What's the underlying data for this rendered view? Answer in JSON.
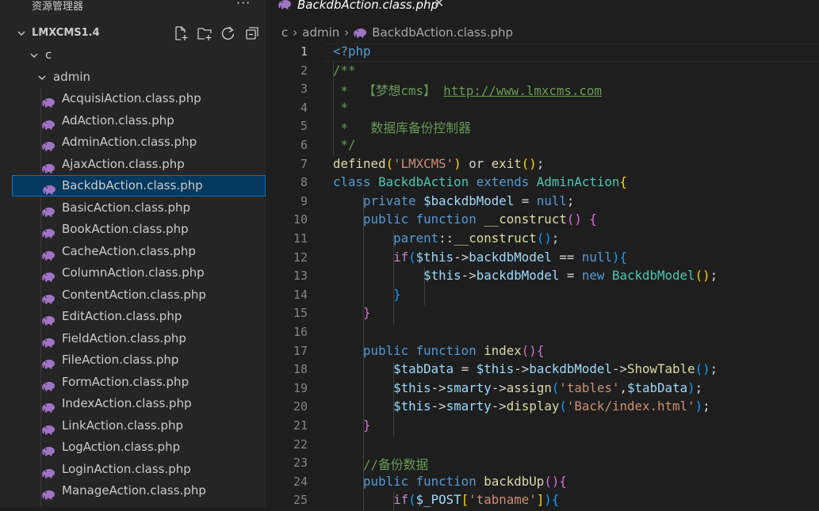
{
  "sidebar": {
    "title": "资源管理器",
    "more": "···",
    "project": "LMXCMS1.4",
    "folders": [
      {
        "label": "c"
      },
      {
        "label": "admin"
      }
    ],
    "files": [
      "AcquisiAction.class.php",
      "AdAction.class.php",
      "AdminAction.class.php",
      "AjaxAction.class.php",
      "BackdbAction.class.php",
      "BasicAction.class.php",
      "BookAction.class.php",
      "CacheAction.class.php",
      "ColumnAction.class.php",
      "ContentAction.class.php",
      "EditAction.class.php",
      "FieldAction.class.php",
      "FileAction.class.php",
      "FormAction.class.php",
      "IndexAction.class.php",
      "LinkAction.class.php",
      "LogAction.class.php",
      "LoginAction.class.php",
      "ManageAction.class.php"
    ],
    "selected_file": "BackdbAction.class.php"
  },
  "tab": {
    "label": "BackdbAction.class.php",
    "close": "✕"
  },
  "breadcrumb": {
    "parts": [
      "c",
      "admin",
      "BackdbAction.class.php"
    ]
  },
  "editor": {
    "current_line": 1,
    "lines": [
      {
        "n": "1",
        "t": [
          [
            "tag",
            "<?php"
          ]
        ]
      },
      {
        "n": "2",
        "t": [
          [
            "com",
            "/**"
          ]
        ]
      },
      {
        "n": "3",
        "t": [
          [
            "com",
            " *  【梦想cms】 "
          ],
          [
            "url",
            "http://www.lmxcms.com"
          ]
        ]
      },
      {
        "n": "4",
        "t": [
          [
            "com",
            " *"
          ]
        ]
      },
      {
        "n": "5",
        "t": [
          [
            "com",
            " *   数据库备份控制器"
          ]
        ]
      },
      {
        "n": "6",
        "t": [
          [
            "com",
            " */"
          ]
        ]
      },
      {
        "n": "7",
        "t": [
          [
            "fn",
            "defined"
          ],
          [
            "b1",
            "("
          ],
          [
            "str",
            "'LMXCMS'"
          ],
          [
            "b1",
            ")"
          ],
          [
            "txt",
            " or "
          ],
          [
            "fn",
            "exit"
          ],
          [
            "b1",
            "()"
          ],
          [
            "txt",
            ";"
          ]
        ]
      },
      {
        "n": "8",
        "t": [
          [
            "kw",
            "class "
          ],
          [
            "cls",
            "BackdbAction "
          ],
          [
            "kw",
            "extends "
          ],
          [
            "cls",
            "AdminAction"
          ],
          [
            "b1",
            "{"
          ]
        ]
      },
      {
        "n": "9",
        "t": [
          [
            "txt",
            "    "
          ],
          [
            "kw",
            "private "
          ],
          [
            "var",
            "$backdbModel"
          ],
          [
            "txt",
            " = "
          ],
          [
            "kw",
            "null"
          ],
          [
            "txt",
            ";"
          ]
        ]
      },
      {
        "n": "10",
        "t": [
          [
            "txt",
            "    "
          ],
          [
            "kw",
            "public function "
          ],
          [
            "fn",
            "__construct"
          ],
          [
            "b2",
            "()"
          ],
          [
            "txt",
            " "
          ],
          [
            "b2",
            "{"
          ]
        ]
      },
      {
        "n": "11",
        "t": [
          [
            "txt",
            "        "
          ],
          [
            "kw",
            "parent"
          ],
          [
            "txt",
            "::"
          ],
          [
            "fn",
            "__construct"
          ],
          [
            "b3",
            "()"
          ],
          [
            "txt",
            ";"
          ]
        ]
      },
      {
        "n": "12",
        "t": [
          [
            "txt",
            "        "
          ],
          [
            "ctl",
            "if"
          ],
          [
            "b3",
            "("
          ],
          [
            "var",
            "$this"
          ],
          [
            "txt",
            "->"
          ],
          [
            "var",
            "backdbModel"
          ],
          [
            "txt",
            " == "
          ],
          [
            "kw",
            "null"
          ],
          [
            "b3",
            ")"
          ],
          [
            "b3",
            "{"
          ]
        ]
      },
      {
        "n": "13",
        "t": [
          [
            "txt",
            "            "
          ],
          [
            "var",
            "$this"
          ],
          [
            "txt",
            "->"
          ],
          [
            "var",
            "backdbModel"
          ],
          [
            "txt",
            " = "
          ],
          [
            "kw",
            "new "
          ],
          [
            "cls",
            "BackdbModel"
          ],
          [
            "b1",
            "()"
          ],
          [
            "txt",
            ";"
          ]
        ]
      },
      {
        "n": "14",
        "t": [
          [
            "txt",
            "        "
          ],
          [
            "b3",
            "}"
          ]
        ]
      },
      {
        "n": "15",
        "t": [
          [
            "txt",
            "    "
          ],
          [
            "b2",
            "}"
          ]
        ]
      },
      {
        "n": "16",
        "t": []
      },
      {
        "n": "17",
        "t": [
          [
            "txt",
            "    "
          ],
          [
            "kw",
            "public function "
          ],
          [
            "fn",
            "index"
          ],
          [
            "b2",
            "()"
          ],
          [
            "b2",
            "{"
          ]
        ]
      },
      {
        "n": "18",
        "t": [
          [
            "txt",
            "        "
          ],
          [
            "var",
            "$tabData"
          ],
          [
            "txt",
            " = "
          ],
          [
            "var",
            "$this"
          ],
          [
            "txt",
            "->"
          ],
          [
            "var",
            "backdbModel"
          ],
          [
            "txt",
            "->"
          ],
          [
            "fn",
            "ShowTable"
          ],
          [
            "b3",
            "()"
          ],
          [
            "txt",
            ";"
          ]
        ]
      },
      {
        "n": "19",
        "t": [
          [
            "txt",
            "        "
          ],
          [
            "var",
            "$this"
          ],
          [
            "txt",
            "->"
          ],
          [
            "var",
            "smarty"
          ],
          [
            "txt",
            "->"
          ],
          [
            "fn",
            "assign"
          ],
          [
            "b3",
            "("
          ],
          [
            "str",
            "'tables'"
          ],
          [
            "txt",
            ","
          ],
          [
            "var",
            "$tabData"
          ],
          [
            "b3",
            ")"
          ],
          [
            "txt",
            ";"
          ]
        ]
      },
      {
        "n": "20",
        "t": [
          [
            "txt",
            "        "
          ],
          [
            "var",
            "$this"
          ],
          [
            "txt",
            "->"
          ],
          [
            "var",
            "smarty"
          ],
          [
            "txt",
            "->"
          ],
          [
            "fn",
            "display"
          ],
          [
            "b3",
            "("
          ],
          [
            "str",
            "'Back/index.html'"
          ],
          [
            "b3",
            ")"
          ],
          [
            "txt",
            ";"
          ]
        ]
      },
      {
        "n": "21",
        "t": [
          [
            "txt",
            "    "
          ],
          [
            "b2",
            "}"
          ]
        ]
      },
      {
        "n": "22",
        "t": []
      },
      {
        "n": "23",
        "t": [
          [
            "txt",
            "    "
          ],
          [
            "com",
            "//备份数据"
          ]
        ]
      },
      {
        "n": "24",
        "t": [
          [
            "txt",
            "    "
          ],
          [
            "kw",
            "public function "
          ],
          [
            "fn",
            "backdbUp"
          ],
          [
            "b2",
            "()"
          ],
          [
            "b2",
            "{"
          ]
        ]
      },
      {
        "n": "25",
        "t": [
          [
            "txt",
            "        "
          ],
          [
            "ctl",
            "if"
          ],
          [
            "b3",
            "("
          ],
          [
            "var",
            "$_POST"
          ],
          [
            "b1",
            "["
          ],
          [
            "str",
            "'tabname'"
          ],
          [
            "b1",
            "]"
          ],
          [
            "b3",
            ")"
          ],
          [
            "b3",
            "{"
          ]
        ]
      }
    ]
  },
  "colors": {
    "sidebar_bg": "#252526",
    "editor_bg": "#1e1e1e",
    "selection_bg": "#04395e",
    "selection_border": "#0e70c0",
    "php_icon": "#a074c4"
  },
  "icons": [
    "chevron-down-icon",
    "new-file-icon",
    "new-folder-icon",
    "refresh-icon",
    "collapse-all-icon",
    "php-elephant-icon",
    "close-icon",
    "chevron-right-icon"
  ]
}
